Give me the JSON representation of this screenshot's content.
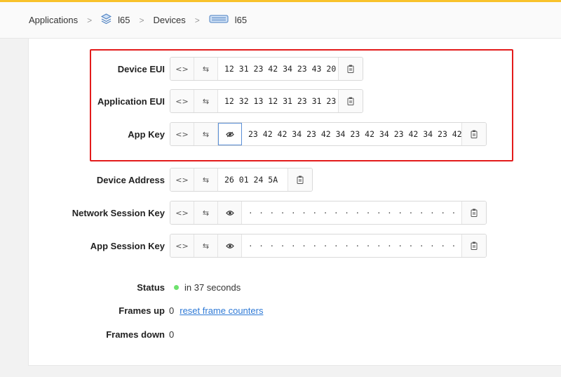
{
  "breadcrumb": {
    "applications": "Applications",
    "application_name": "l65",
    "devices": "Devices",
    "device_name": "l65"
  },
  "keys": {
    "device_eui": {
      "label": "Device EUI",
      "value": "12 31 23 42 34 23 43 20"
    },
    "application_eui": {
      "label": "Application EUI",
      "value": "12 32 13 12 31 23 31 23"
    },
    "app_key": {
      "label": "App Key",
      "value": "23 42 42 34 23 42 34 23 42 34 23 42 34 23 42 34"
    },
    "device_address": {
      "label": "Device Address",
      "value": "26 01 24 5A"
    },
    "network_session_key": {
      "label": "Network Session Key",
      "value": "· · · · · · · · · · · · · · · · · · · · · · · · · · · · · · · ·"
    },
    "app_session_key": {
      "label": "App Session Key",
      "value": "· · · · · · · · · · · · · · · · · · · · · · · · · · · · · · · ·"
    }
  },
  "status": {
    "label": "Status",
    "value": "in 37 seconds",
    "color": "#6ee26e"
  },
  "frames_up": {
    "label": "Frames up",
    "value": "0",
    "reset_link": "reset frame counters"
  },
  "frames_down": {
    "label": "Frames down",
    "value": "0"
  },
  "colors": {
    "accent_bar": "#f8c22b",
    "highlight_box": "#e31b1b",
    "link": "#2f7ad6"
  }
}
